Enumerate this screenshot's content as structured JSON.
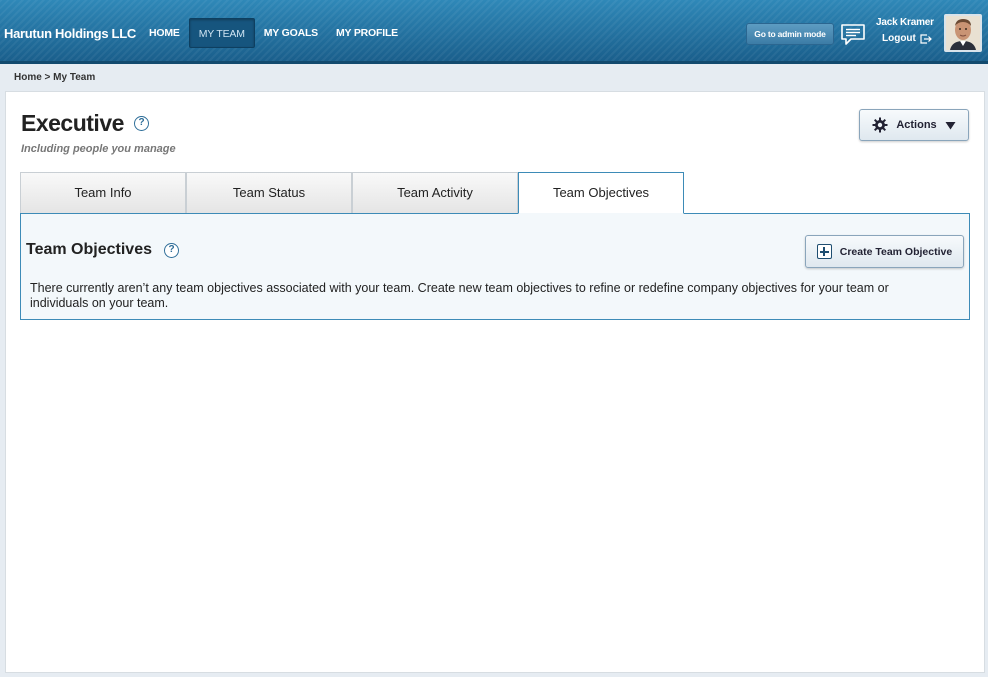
{
  "header": {
    "brand": "Harutun Holdings LLC",
    "nav": [
      {
        "label": "HOME",
        "active": false
      },
      {
        "label": "MY TEAM",
        "active": true
      },
      {
        "label": "MY GOALS",
        "active": false
      },
      {
        "label": "MY PROFILE",
        "active": false
      }
    ],
    "admin_button": "Go to admin mode",
    "user_name": "Jack Kramer",
    "logout": "Logout",
    "icons": {
      "messages": "chat-bubble-icon",
      "logout": "logout-arrow-icon",
      "avatar": "user-photo"
    }
  },
  "breadcrumb": "Home > My Team",
  "page": {
    "title": "Executive",
    "subtitle": "Including people you manage",
    "actions_label": "Actions"
  },
  "tabs": [
    {
      "label": "Team Info",
      "active": false
    },
    {
      "label": "Team Status",
      "active": false
    },
    {
      "label": "Team Activity",
      "active": false
    },
    {
      "label": "Team Objectives",
      "active": true
    }
  ],
  "objectives": {
    "title": "Team Objectives",
    "create_button": "Create Team Objective",
    "empty_message": "There currently aren’t any team objectives associated with your team. Create new team objectives to refine or redefine company objectives for your team or individuals on your team."
  },
  "colors": {
    "header_top": "#2f88b8",
    "header_bottom": "#1a5f8c",
    "accent": "#3d8bb7",
    "background": "#e6ecf2"
  }
}
